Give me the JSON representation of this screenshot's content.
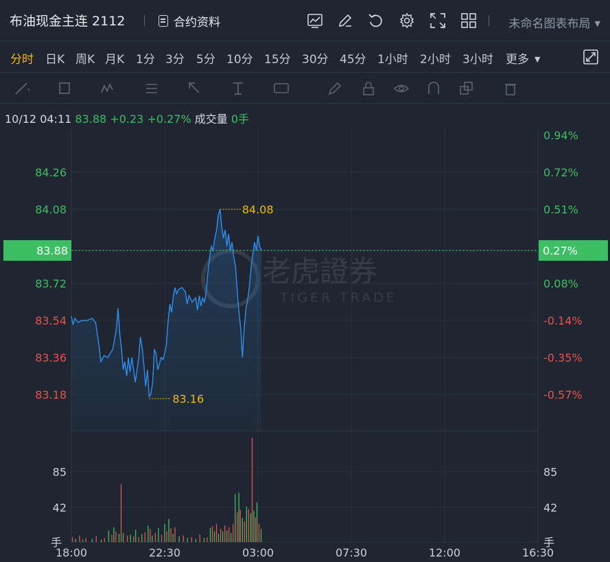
{
  "header": {
    "title": "布油现金主连 2112",
    "contract_label": "合约资料",
    "layout_name": "未命名图表布局",
    "icons": [
      "chart-indicator-icon",
      "edit-icon",
      "undo-icon",
      "settings-icon",
      "fullscreen-icon",
      "grid-layout-icon"
    ]
  },
  "tabs": [
    {
      "label": "分时",
      "active": true
    },
    {
      "label": "日K"
    },
    {
      "label": "周K"
    },
    {
      "label": "月K"
    },
    {
      "label": "1分"
    },
    {
      "label": "3分"
    },
    {
      "label": "5分"
    },
    {
      "label": "10分"
    },
    {
      "label": "15分"
    },
    {
      "label": "30分"
    },
    {
      "label": "45分"
    },
    {
      "label": "1小时"
    },
    {
      "label": "2小时"
    },
    {
      "label": "3小时"
    },
    {
      "label": "更多"
    }
  ],
  "info": {
    "datetime": "10/12 04:11",
    "price": "83.88",
    "change": "+0.23",
    "change_pct": "+0.27%",
    "volume_label": "成交量",
    "volume": "0手"
  },
  "watermark": {
    "cn": "老虎證券",
    "en": "TIGER TRADE"
  },
  "colors": {
    "up": "#3dbe62",
    "down": "#e8534b",
    "line": "#2f8ff0",
    "accent": "#f0b90b",
    "bg": "#1f2631"
  },
  "chart_data": {
    "type": "line",
    "x_ticks": [
      "18:00",
      "22:30",
      "03:00",
      "07:30",
      "12:00",
      "16:30"
    ],
    "y_ticks_left": [
      "84.26",
      "84.08",
      "83.72",
      "83.54",
      "83.36",
      "83.18"
    ],
    "y_ticks_right": [
      "0.94%",
      "0.72%",
      "0.51%",
      "0.08%",
      "-0.14%",
      "-0.35%",
      "-0.57%"
    ],
    "current": {
      "price": "83.88",
      "pct": "0.27%"
    },
    "high": {
      "value": 84.08,
      "label": "84.08"
    },
    "low": {
      "value": 83.16,
      "label": "83.16"
    },
    "price_series": [
      [
        18.0,
        83.56
      ],
      [
        18.08,
        83.52
      ],
      [
        18.17,
        83.55
      ],
      [
        18.33,
        83.53
      ],
      [
        18.5,
        83.54
      ],
      [
        18.75,
        83.54
      ],
      [
        19.0,
        83.55
      ],
      [
        19.17,
        83.53
      ],
      [
        19.33,
        83.42
      ],
      [
        19.42,
        83.34
      ],
      [
        19.58,
        83.37
      ],
      [
        19.75,
        83.36
      ],
      [
        20.0,
        83.4
      ],
      [
        20.17,
        83.5
      ],
      [
        20.25,
        83.6
      ],
      [
        20.33,
        83.48
      ],
      [
        20.42,
        83.4
      ],
      [
        20.5,
        83.3
      ],
      [
        20.58,
        83.34
      ],
      [
        20.67,
        83.27
      ],
      [
        20.75,
        83.36
      ],
      [
        20.83,
        83.29
      ],
      [
        20.92,
        83.36
      ],
      [
        21.0,
        83.3
      ],
      [
        21.08,
        83.24
      ],
      [
        21.17,
        83.3
      ],
      [
        21.25,
        83.36
      ],
      [
        21.33,
        83.46
      ],
      [
        21.42,
        83.4
      ],
      [
        21.5,
        83.32
      ],
      [
        21.58,
        83.22
      ],
      [
        21.67,
        83.3
      ],
      [
        21.75,
        83.17
      ],
      [
        21.83,
        83.18
      ],
      [
        21.92,
        83.24
      ],
      [
        22.0,
        83.4
      ],
      [
        22.08,
        83.38
      ],
      [
        22.17,
        83.3
      ],
      [
        22.25,
        83.33
      ],
      [
        22.33,
        83.36
      ],
      [
        22.42,
        83.35
      ],
      [
        22.5,
        83.38
      ],
      [
        22.58,
        83.42
      ],
      [
        22.67,
        83.54
      ],
      [
        22.75,
        83.62
      ],
      [
        22.83,
        83.58
      ],
      [
        22.92,
        83.66
      ],
      [
        23.0,
        83.7
      ],
      [
        23.08,
        83.67
      ],
      [
        23.17,
        83.69
      ],
      [
        23.33,
        83.7
      ],
      [
        23.5,
        83.68
      ],
      [
        23.58,
        83.62
      ],
      [
        23.67,
        83.66
      ],
      [
        23.83,
        83.63
      ],
      [
        24.0,
        83.65
      ],
      [
        24.08,
        83.59
      ],
      [
        24.17,
        83.66
      ],
      [
        24.25,
        83.61
      ],
      [
        24.33,
        83.65
      ],
      [
        24.42,
        83.63
      ],
      [
        24.5,
        83.68
      ],
      [
        24.58,
        83.77
      ],
      [
        24.67,
        83.85
      ],
      [
        24.75,
        83.9
      ],
      [
        24.83,
        83.88
      ],
      [
        24.92,
        83.94
      ],
      [
        25.0,
        83.98
      ],
      [
        25.08,
        84.05
      ],
      [
        25.17,
        84.08
      ],
      [
        25.25,
        84.0
      ],
      [
        25.33,
        83.94
      ],
      [
        25.42,
        83.98
      ],
      [
        25.5,
        83.9
      ],
      [
        25.58,
        83.96
      ],
      [
        25.67,
        83.88
      ],
      [
        25.75,
        83.92
      ],
      [
        25.83,
        83.85
      ],
      [
        25.92,
        83.8
      ],
      [
        26.0,
        83.68
      ],
      [
        26.08,
        83.58
      ],
      [
        26.17,
        83.5
      ],
      [
        26.25,
        83.36
      ],
      [
        26.33,
        83.5
      ],
      [
        26.42,
        83.6
      ],
      [
        26.5,
        83.64
      ],
      [
        26.58,
        83.7
      ],
      [
        26.67,
        83.8
      ],
      [
        26.75,
        83.86
      ],
      [
        26.83,
        83.92
      ],
      [
        26.92,
        83.88
      ],
      [
        27.0,
        83.95
      ],
      [
        27.08,
        83.9
      ],
      [
        27.17,
        83.88
      ]
    ],
    "volume_ticks": [
      "85",
      "42",
      "手"
    ],
    "volume_series": [
      [
        18.05,
        6,
        0
      ],
      [
        18.2,
        4,
        1
      ],
      [
        18.4,
        8,
        0
      ],
      [
        18.55,
        3,
        1
      ],
      [
        18.7,
        5,
        0
      ],
      [
        19.0,
        4,
        1
      ],
      [
        19.2,
        7,
        0
      ],
      [
        19.45,
        3,
        1
      ],
      [
        19.6,
        5,
        0
      ],
      [
        19.8,
        14,
        1
      ],
      [
        19.95,
        9,
        0
      ],
      [
        20.05,
        18,
        1
      ],
      [
        20.15,
        13,
        0
      ],
      [
        20.3,
        10,
        1
      ],
      [
        20.4,
        70,
        0
      ],
      [
        20.5,
        11,
        1
      ],
      [
        20.7,
        8,
        0
      ],
      [
        20.85,
        9,
        1
      ],
      [
        21.0,
        7,
        0
      ],
      [
        21.1,
        15,
        1
      ],
      [
        21.25,
        6,
        0
      ],
      [
        21.4,
        10,
        1
      ],
      [
        21.55,
        12,
        0
      ],
      [
        21.7,
        20,
        1
      ],
      [
        21.8,
        16,
        0
      ],
      [
        21.9,
        8,
        1
      ],
      [
        22.05,
        11,
        0
      ],
      [
        22.2,
        17,
        1
      ],
      [
        22.35,
        9,
        0
      ],
      [
        22.5,
        22,
        1
      ],
      [
        22.6,
        13,
        0
      ],
      [
        22.7,
        28,
        1
      ],
      [
        22.8,
        17,
        0
      ],
      [
        22.9,
        10,
        1
      ],
      [
        23.0,
        18,
        0
      ],
      [
        23.2,
        7,
        1
      ],
      [
        23.4,
        8,
        0
      ],
      [
        23.6,
        5,
        1
      ],
      [
        23.8,
        6,
        0
      ],
      [
        24.0,
        4,
        1
      ],
      [
        24.2,
        9,
        0
      ],
      [
        24.4,
        5,
        1
      ],
      [
        24.55,
        6,
        0
      ],
      [
        24.7,
        17,
        1
      ],
      [
        24.8,
        19,
        0
      ],
      [
        24.9,
        13,
        1
      ],
      [
        25.0,
        22,
        0
      ],
      [
        25.1,
        10,
        1
      ],
      [
        25.2,
        16,
        0
      ],
      [
        25.3,
        13,
        1
      ],
      [
        25.4,
        20,
        0
      ],
      [
        25.5,
        14,
        1
      ],
      [
        25.6,
        18,
        0
      ],
      [
        25.7,
        11,
        1
      ],
      [
        25.8,
        22,
        0
      ],
      [
        25.9,
        58,
        1
      ],
      [
        26.0,
        36,
        0
      ],
      [
        26.08,
        60,
        1
      ],
      [
        26.15,
        39,
        0
      ],
      [
        26.25,
        29,
        1
      ],
      [
        26.35,
        25,
        0
      ],
      [
        26.45,
        43,
        1
      ],
      [
        26.55,
        40,
        0
      ],
      [
        26.65,
        35,
        1
      ],
      [
        26.72,
        126,
        0
      ],
      [
        26.8,
        38,
        1
      ],
      [
        26.88,
        30,
        0
      ],
      [
        26.95,
        48,
        1
      ],
      [
        27.05,
        22,
        0
      ],
      [
        27.15,
        16,
        1
      ]
    ]
  }
}
